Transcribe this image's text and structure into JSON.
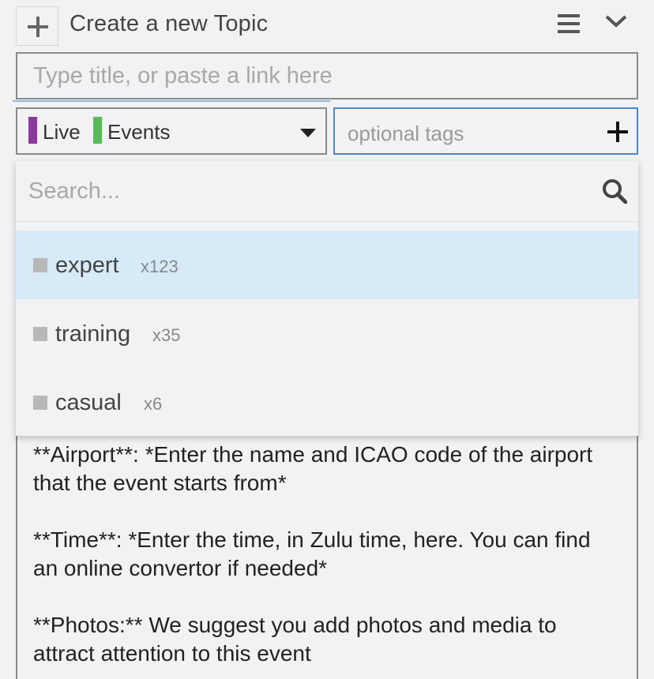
{
  "header": {
    "title": "Create a new Topic",
    "add_icon": "plus-icon",
    "menu_icon": "hamburger-menu-icon",
    "collapse_icon": "chevron-down-icon"
  },
  "title_input": {
    "placeholder": "Type title, or paste a link here",
    "value": ""
  },
  "category": {
    "parent": {
      "label": "Live",
      "color": "#8b3a9c"
    },
    "child": {
      "label": "Events",
      "color": "#5cb85c"
    },
    "caret_icon": "caret-down-icon"
  },
  "tags": {
    "placeholder": "optional tags",
    "add_icon": "plus-icon",
    "focus_color": "#4a86c8"
  },
  "dropdown": {
    "search_placeholder": "Search...",
    "search_icon": "magnifier-icon",
    "highlight_color": "#d6eaf8",
    "options": [
      {
        "name": "expert",
        "count": "x123"
      },
      {
        "name": "training",
        "count": "x35"
      },
      {
        "name": "casual",
        "count": "x6"
      }
    ]
  },
  "body": {
    "paragraphs": [
      "**Airport**: *Enter the name and ICAO code of the airport that the event starts from*",
      "**Time**: *Enter the time, in Zulu time, here. You can find an online convertor if needed*",
      "**Photos:** We suggest you add photos and media to attract attention to this event"
    ]
  }
}
